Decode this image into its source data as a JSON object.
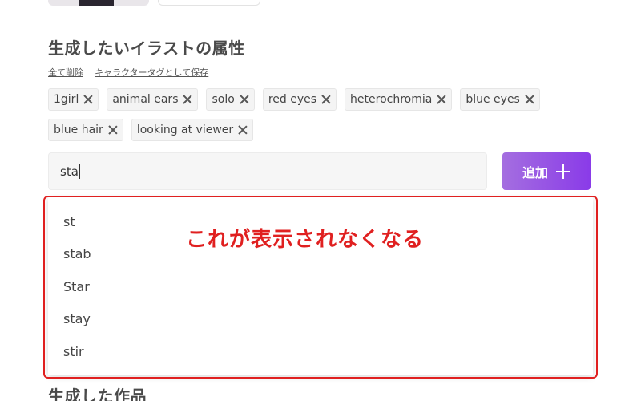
{
  "section": {
    "title": "生成したいイラストの属性",
    "links": {
      "delete_all": "全て削除",
      "save_as_tag": "キャラクタータグとして保存"
    }
  },
  "tags": {
    "row1": [
      "1girl",
      "animal ears",
      "solo",
      "red eyes",
      "heterochromia",
      "blue eyes"
    ],
    "row2": [
      "blue hair",
      "looking at viewer"
    ]
  },
  "search": {
    "value": "sta"
  },
  "add_button": {
    "label": "追加"
  },
  "suggestions": [
    "st",
    "stab",
    "Star",
    "stay",
    "stir"
  ],
  "annotation": {
    "text": "これが表示されなくなる",
    "color": "#e02020"
  },
  "bottom_section": {
    "title": "生成した作品"
  },
  "colors": {
    "accent_start": "#a46ee0",
    "accent_end": "#8a3be8",
    "annotation": "#e02020"
  }
}
